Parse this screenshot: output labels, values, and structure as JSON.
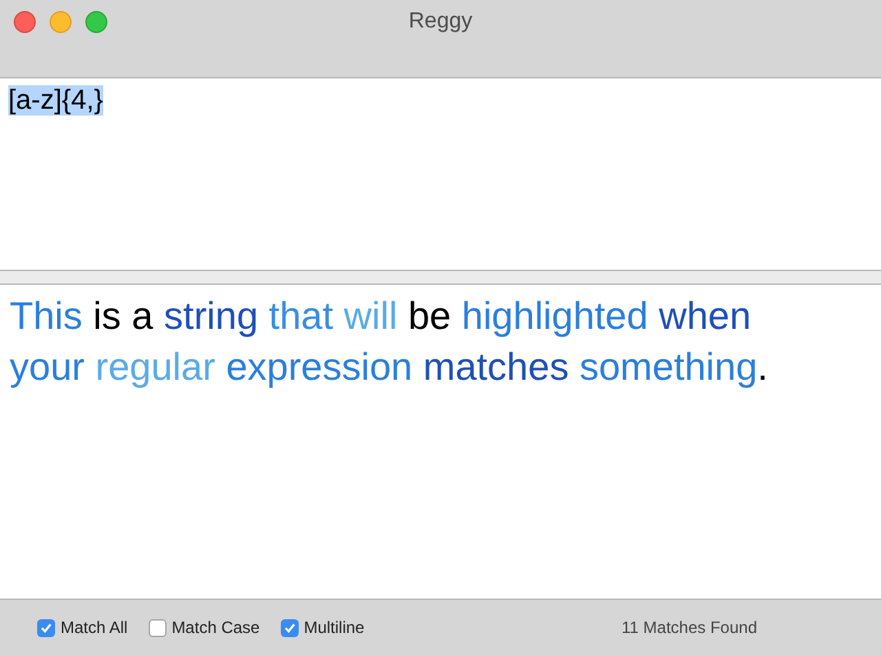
{
  "window": {
    "title": "Reggy"
  },
  "pattern": {
    "value": "[a-z]{4,}",
    "selected": true
  },
  "test_text": [
    {
      "text": "This",
      "color": "#2b7fdc"
    },
    {
      "text": " is a "
    },
    {
      "text": "string ",
      "color": "#1f4fb8"
    },
    {
      "text": "that ",
      "color": "#3a8ee0"
    },
    {
      "text": "will",
      "color": "#5aaae8"
    },
    {
      "text": " be "
    },
    {
      "text": "highlighted ",
      "color": "#2b7fdc"
    },
    {
      "text": "when ",
      "color": "#1f4fb8"
    },
    {
      "text": "your ",
      "color": "#2b7fdc"
    },
    {
      "text": "regular ",
      "color": "#5aaae8"
    },
    {
      "text": "expression ",
      "color": "#2b7fdc"
    },
    {
      "text": "matches ",
      "color": "#1f4fb8"
    },
    {
      "text": "something",
      "color": "#2b7fdc"
    },
    {
      "text": "."
    }
  ],
  "options": [
    {
      "label": "Match All",
      "checked": true
    },
    {
      "label": "Match Case",
      "checked": false
    },
    {
      "label": "Multiline",
      "checked": true
    }
  ],
  "status": "11 Matches Found"
}
